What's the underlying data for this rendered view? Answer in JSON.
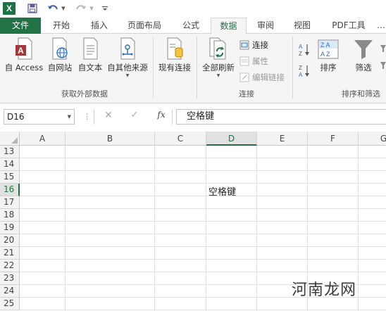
{
  "quick_access": {
    "app_icon": "excel-logo",
    "app_letter": "X",
    "items": [
      "save-icon",
      "undo-icon",
      "redo-icon",
      "customize-icon"
    ]
  },
  "tabs": [
    {
      "label": "文件"
    },
    {
      "label": "开始"
    },
    {
      "label": "插入"
    },
    {
      "label": "页面布局"
    },
    {
      "label": "公式"
    },
    {
      "label": "数据"
    },
    {
      "label": "审阅"
    },
    {
      "label": "视图"
    },
    {
      "label": "PDF工具"
    }
  ],
  "active_tab": "数据",
  "ribbon": {
    "get_external": {
      "label": "获取外部数据",
      "buttons": [
        "自 Access",
        "自网站",
        "自文本",
        "自其他来源"
      ]
    },
    "existing_conn": "现有连接",
    "connections": {
      "label": "连接",
      "refresh_all": "全部刷新",
      "small": [
        "连接",
        "属性",
        "编辑链接"
      ]
    },
    "sort_filter": {
      "label": "排序和筛选",
      "sort": "排序",
      "filter": "筛选"
    }
  },
  "formula_bar": {
    "name_box": "D16",
    "content": "空格键"
  },
  "sheet": {
    "columns": [
      "A",
      "B",
      "C",
      "D",
      "E",
      "F",
      "G"
    ],
    "selected_column": "D",
    "rows": [
      "13",
      "14",
      "15",
      "16",
      "17",
      "18",
      "19",
      "20",
      "21",
      "22",
      "23",
      "24",
      "25"
    ],
    "selected_row": "16",
    "cell_d16": "空格键"
  },
  "watermark": "河南龙网",
  "colors": {
    "accent": "#217346",
    "ribbon_bg": "#f5f5f5",
    "grid_line": "#e1e1e1"
  }
}
